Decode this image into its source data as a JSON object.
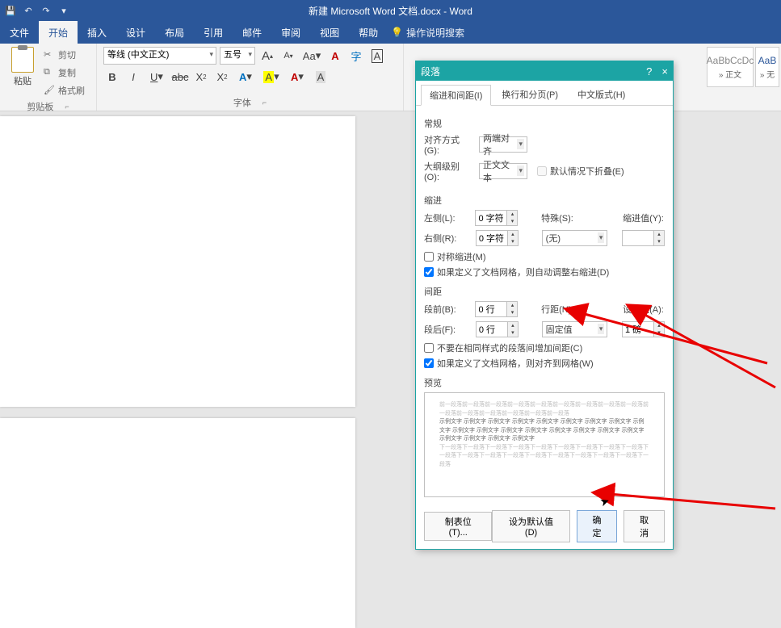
{
  "app": {
    "title": "新建 Microsoft Word 文档.docx - Word"
  },
  "qat": {
    "save": "save",
    "undo": "undo",
    "redo": "redo"
  },
  "menu": {
    "file": "文件",
    "home": "开始",
    "insert": "插入",
    "design": "设计",
    "layout": "布局",
    "references": "引用",
    "mail": "邮件",
    "review": "审阅",
    "view": "视图",
    "help": "帮助",
    "tell_me": "操作说明搜索"
  },
  "ribbon": {
    "clipboard": {
      "paste": "粘贴",
      "cut": "剪切",
      "copy": "复制",
      "format_painter": "格式刷",
      "label": "剪贴板"
    },
    "font": {
      "name": "等线 (中文正文)",
      "size": "五号",
      "label": "字体",
      "bold": "B",
      "italic": "I",
      "underline": "U",
      "strike": "abc",
      "sub": "X",
      "sup": "X",
      "grow": "A",
      "shrink": "A",
      "caps": "Aa",
      "clear": "A",
      "phonetic": "字",
      "charborder": "A",
      "highlight": "A",
      "fontcolor": "A",
      "bordered": "A"
    },
    "styles": {
      "normal_sample": "AaBbCcDc",
      "normal_label": "» 正文",
      "nospace_sample": "AaB",
      "nospace_label": "» 无"
    }
  },
  "dialog": {
    "title": "段落",
    "help": "?",
    "close": "×",
    "tabs": {
      "indent": "缩进和间距(I)",
      "page": "换行和分页(P)",
      "chinese": "中文版式(H)"
    },
    "general": {
      "label": "常规",
      "align_label": "对齐方式(G):",
      "align_value": "两端对齐",
      "outline_label": "大纲级别(O):",
      "outline_value": "正文文本",
      "collapse": "默认情况下折叠(E)"
    },
    "indent": {
      "label": "缩进",
      "left_label": "左侧(L):",
      "left_value": "0 字符",
      "right_label": "右侧(R):",
      "right_value": "0 字符",
      "special_label": "特殊(S):",
      "special_value": "(无)",
      "by_label": "缩进值(Y):",
      "by_value": "",
      "mirror": "对称缩进(M)",
      "autogrid": "如果定义了文档网格，则自动调整右缩进(D)"
    },
    "spacing": {
      "label": "间距",
      "before_label": "段前(B):",
      "before_value": "0 行",
      "after_label": "段后(F):",
      "after_value": "0 行",
      "line_label": "行距(N):",
      "line_value": "固定值",
      "at_label": "设置值(A):",
      "at_value": "1 磅",
      "noadd": "不要在相同样式的段落间增加间距(C)",
      "snapgrid": "如果定义了文档网格，则对齐到网格(W)"
    },
    "preview": {
      "label": "预览",
      "faint1": "前一段落前一段落前一段落前一段落前一段落前一段落前一段落前一段落前一段落前一段落前一段落前一段落前一段落前一段落前一段落",
      "dark": "示例文字 示例文字 示例文字 示例文字 示例文字 示例文字 示例文字 示例文字 示例文字 示例文字 示例文字 示例文字 示例文字 示例文字 示例文字 示例文字 示例文字 示例文字 示例文字 示例文字 示例文字",
      "faint2": "下一段落下一段落下一段落下一段落下一段落下一段落下一段落下一段落下一段落下一段落下一段落下一段落下一段落下一段落下一段落下一段落下一段落下一段落下一段落"
    },
    "footer": {
      "tabs": "制表位(T)...",
      "default": "设为默认值(D)",
      "ok": "确定",
      "cancel": "取消"
    }
  }
}
